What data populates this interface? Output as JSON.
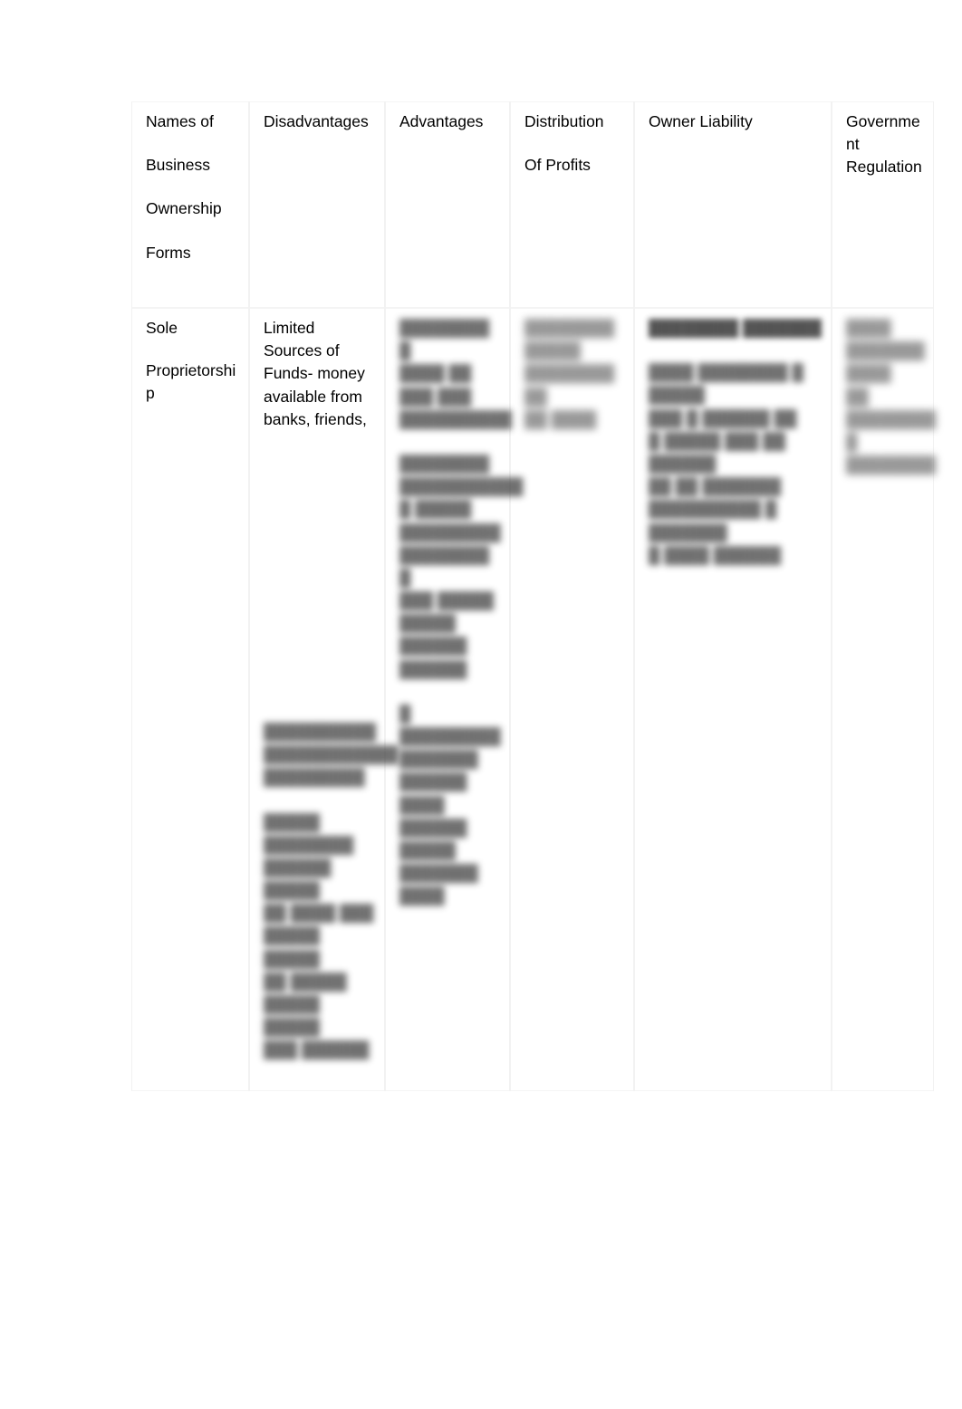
{
  "document": {
    "type": "comparison-table",
    "page_background": "#ffffff",
    "text_color": "#000000"
  },
  "table": {
    "columns": [
      {
        "key": "names",
        "header_lines": [
          "Names of",
          "Business",
          "Ownership",
          "Forms"
        ]
      },
      {
        "key": "disadvantages",
        "header_lines": [
          "Disadvantages"
        ]
      },
      {
        "key": "advantages",
        "header_lines": [
          "Advantages"
        ]
      },
      {
        "key": "distribution",
        "header_lines": [
          "Distribution",
          "Of Profits"
        ]
      },
      {
        "key": "liability",
        "header_lines": [
          "Owner Liability"
        ]
      },
      {
        "key": "regulation",
        "header_lines": [
          "Governme",
          "nt",
          "Regulation"
        ]
      }
    ],
    "rows": [
      {
        "names": {
          "legible": true,
          "lines": [
            "Sole",
            "Proprietorshi",
            "p"
          ]
        },
        "disadvantages": {
          "legible": true,
          "lines": [
            "Limited",
            "Sources of",
            "Funds- money",
            "available from",
            "banks, friends,"
          ],
          "redacted_blocks": [
            {
              "lines": [
                "██████████",
                "████████████",
                "█████████"
              ]
            },
            {
              "lines": [
                "█████",
                "████████",
                "██████ █████",
                "██ ████ ███",
                "█████ █████",
                "██ █████",
                "█████ █████",
                "███ ██████"
              ]
            }
          ]
        },
        "advantages": {
          "legible": false,
          "redacted_blocks": [
            {
              "lines": [
                "████████ █",
                "████ ██",
                "███ ███",
                "██████████"
              ]
            },
            {
              "lines": [
                "████████",
                "███████████",
                "█ █████",
                "█████████",
                "████████ █",
                "███ █████",
                "█████ ██████",
                "██████"
              ]
            },
            {
              "lines": [
                "█ █████████",
                "███████",
                "██████ ████",
                "██████",
                "█████ ███████",
                "████"
              ]
            }
          ]
        },
        "distribution": {
          "legible": false,
          "redacted_blocks": [
            {
              "lines": [
                "████████",
                "█████",
                "████████ ██",
                "██ ████"
              ]
            }
          ]
        },
        "liability": {
          "legible": false,
          "redacted_blocks": [
            {
              "emphasis": true,
              "lines": [
                "████████ ███████"
              ]
            },
            {
              "lines": [
                "████ ████████ █ █████",
                "███ █ ██████ ██",
                "█ █████ ███ ██ ██████",
                "██ ██ ███████",
                "██████████ █ ███████",
                "█ ████ ██████"
              ]
            }
          ]
        },
        "regulation": {
          "legible": false,
          "redacted_blocks": [
            {
              "lines": [
                "████",
                "███████",
                "████",
                "██ ████████",
                "█ ████████"
              ]
            }
          ]
        }
      }
    ]
  }
}
